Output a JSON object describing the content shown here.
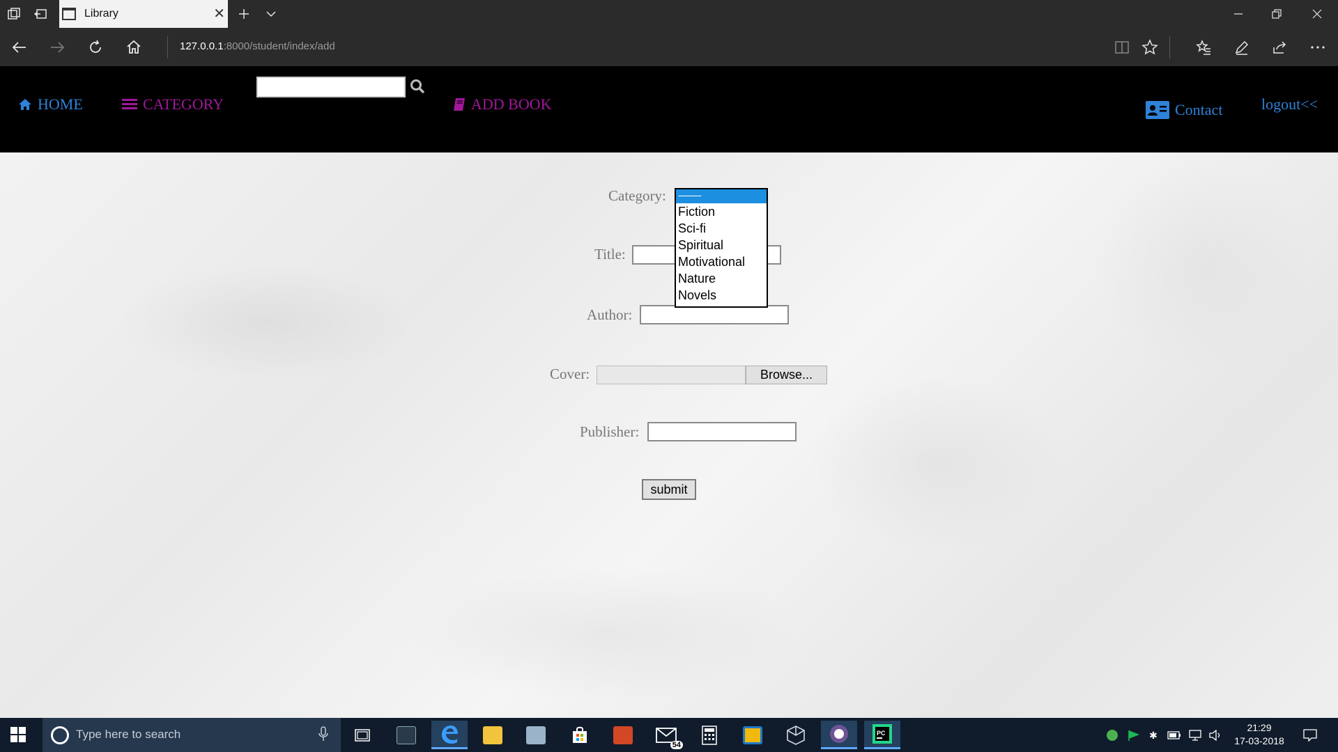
{
  "browser": {
    "tab_title": "Library",
    "url_host": "127.0.0.1",
    "url_path": ":8000/student/index/add"
  },
  "nav": {
    "home": "HOME",
    "category": "CATEGORY",
    "add_book": "ADD BOOK",
    "contact": "Contact",
    "logout": "logout<<",
    "search_value": ""
  },
  "form": {
    "category_label": "Category:",
    "title_label": "Title:",
    "author_label": "Author:",
    "cover_label": "Cover:",
    "publisher_label": "Publisher:",
    "browse_label": "Browse...",
    "submit_label": "submit",
    "title_value": "",
    "author_value": "",
    "publisher_value": "",
    "category_selected": "---------",
    "category_options": [
      "Fiction",
      "Sci-fi",
      "Spiritual",
      "Motivational",
      "Nature",
      "Novels"
    ]
  },
  "taskbar": {
    "search_placeholder": "Type here to search",
    "time": "21:29",
    "date": "17-03-2018",
    "mail_badge": "54"
  },
  "colors": {
    "nav_blue": "#2e82d8",
    "nav_magenta": "#a0189a",
    "dropdown_highlight": "#1d8fe0"
  }
}
